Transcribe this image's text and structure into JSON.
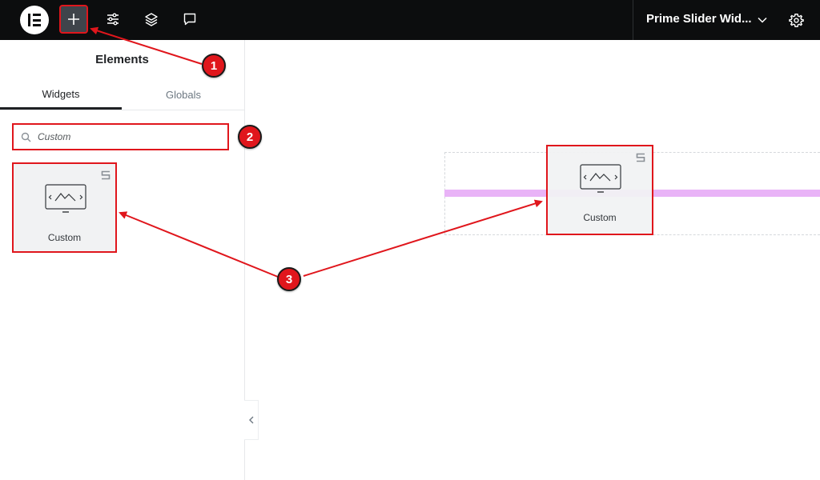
{
  "topbar": {
    "document_title": "Prime Slider Wid...",
    "buttons": [
      {
        "name": "add-element",
        "icon": "plus-icon",
        "active": true
      },
      {
        "name": "site-settings",
        "icon": "sliders-icon"
      },
      {
        "name": "structure",
        "icon": "layers-icon"
      },
      {
        "name": "notes",
        "icon": "comment-icon"
      }
    ],
    "right_icons": [
      "chevron-down-icon",
      "gear-icon"
    ]
  },
  "panel": {
    "title": "Elements",
    "tabs": [
      {
        "label": "Widgets",
        "active": true
      },
      {
        "label": "Globals",
        "active": false
      }
    ],
    "search": {
      "value": "Custom",
      "icon": "search-icon"
    },
    "widget": {
      "label": "Custom",
      "icon": "custom-slider-icon",
      "badge_icon": "s-badge-icon"
    }
  },
  "canvas": {
    "dragged_widget": {
      "label": "Custom"
    }
  },
  "annotations": {
    "steps": [
      "1",
      "2",
      "3"
    ],
    "highlight_color": "#e0161c"
  },
  "colors": {
    "topbar_bg": "#0c0d0e",
    "accent_red": "#e0161c",
    "drop_indicator": "#e9b3f7"
  }
}
